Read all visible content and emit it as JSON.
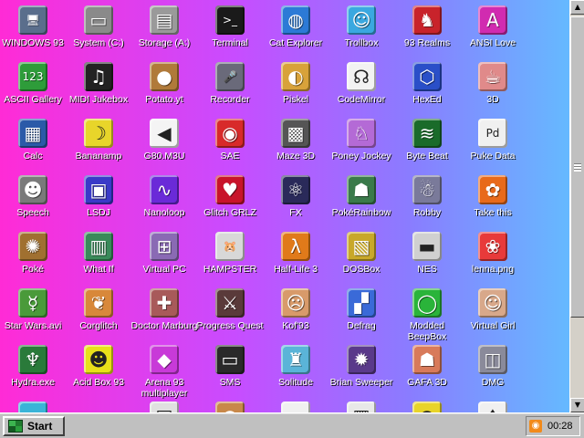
{
  "desktop": {
    "rows": [
      [
        {
          "label": "WINDOWS 93",
          "icon": "computer-icon",
          "glyph": "🖥",
          "color": "#5a6e8c"
        },
        {
          "label": "System (C:)",
          "icon": "hard-drive-icon",
          "glyph": "▭",
          "color": "#8a8a8a"
        },
        {
          "label": "Storage (A:)",
          "icon": "floppy-drive-icon",
          "glyph": "▤",
          "color": "#9a9a9a"
        },
        {
          "label": "Terminal",
          "icon": "terminal-icon",
          "glyph": ">_",
          "color": "#1a1a1a"
        },
        {
          "label": "Cat Explorer",
          "icon": "globe-cat-icon",
          "glyph": "◍",
          "color": "#2c7ad6"
        },
        {
          "label": "Trollbox",
          "icon": "troll-face-icon",
          "glyph": "☺",
          "color": "#3aa8e0"
        },
        {
          "label": "93 Realms",
          "icon": "red-dragon-icon",
          "glyph": "♞",
          "color": "#c8232b"
        },
        {
          "label": "ANSI Love",
          "icon": "letter-a-icon",
          "glyph": "A",
          "color": "#d12bb0"
        }
      ],
      [
        {
          "label": "ASCII Gallery",
          "icon": "ascii-numbers-icon",
          "glyph": "123",
          "color": "#2e9c3a"
        },
        {
          "label": "MIDI Jukebox",
          "icon": "piano-keys-icon",
          "glyph": "♫",
          "color": "#222222"
        },
        {
          "label": "Potato.yt",
          "icon": "potato-icon",
          "glyph": "●",
          "color": "#b07a3a"
        },
        {
          "label": "Recorder",
          "icon": "microphone-icon",
          "glyph": "🎤",
          "color": "#6a6a7a"
        },
        {
          "label": "Piskel",
          "icon": "paint-palette-icon",
          "glyph": "◐",
          "color": "#d8a23a"
        },
        {
          "label": "CodeMirror",
          "icon": "code-mirror-icon",
          "glyph": "☊",
          "color": "#f2f2f2"
        },
        {
          "label": "HexEd",
          "icon": "hex-cube-icon",
          "glyph": "⬡",
          "color": "#2a4fc8"
        },
        {
          "label": "3D",
          "icon": "teapot-icon",
          "glyph": "☕",
          "color": "#e08a8a"
        }
      ],
      [
        {
          "label": "Calc",
          "icon": "calculator-icon",
          "glyph": "▦",
          "color": "#2b5aa8"
        },
        {
          "label": "Bananamp",
          "icon": "banana-icon",
          "glyph": "☽",
          "color": "#e8d52a"
        },
        {
          "label": "G80.M3U",
          "icon": "playlist-file-icon",
          "glyph": "◀",
          "color": "#f4f4f4"
        },
        {
          "label": "SAE",
          "icon": "checkered-ball-icon",
          "glyph": "◉",
          "color": "#d82a2a"
        },
        {
          "label": "Maze 3D",
          "icon": "maze-icon",
          "glyph": "▩",
          "color": "#555555"
        },
        {
          "label": "Poney Jockey",
          "icon": "pony-icon",
          "glyph": "♘",
          "color": "#b46ad6"
        },
        {
          "label": "Byte Beat",
          "icon": "byte-beat-icon",
          "glyph": "≋",
          "color": "#1a6b2a"
        },
        {
          "label": "Puke Data",
          "icon": "document-pd-icon",
          "glyph": "Pd",
          "color": "#f0f0f0"
        }
      ],
      [
        {
          "label": "Speech",
          "icon": "face-speech-icon",
          "glyph": "☻",
          "color": "#7a7a7a"
        },
        {
          "label": "LSDJ",
          "icon": "gameboy-icon",
          "glyph": "▣",
          "color": "#3a3ac8"
        },
        {
          "label": "Nanoloop",
          "icon": "waveform-icon",
          "glyph": "∿",
          "color": "#6a2ad8"
        },
        {
          "label": "Glitch GRLZ",
          "icon": "red-lips-icon",
          "glyph": "♥",
          "color": "#c8142a"
        },
        {
          "label": "FX",
          "icon": "atom-icon",
          "glyph": "⚛",
          "color": "#2a2a5a"
        },
        {
          "label": "PokéRainbow",
          "icon": "pokemon-group-icon",
          "glyph": "☗",
          "color": "#3a7a4a"
        },
        {
          "label": "Robby",
          "icon": "stick-figure-icon",
          "glyph": "☃",
          "color": "#7a7a9a"
        },
        {
          "label": "Take this",
          "icon": "orange-creature-icon",
          "glyph": "✿",
          "color": "#e86a1a"
        }
      ],
      [
        {
          "label": "Poké",
          "icon": "poke-ascii-icon",
          "glyph": "✺",
          "color": "#a07030"
        },
        {
          "label": "What If",
          "icon": "what-if-window-icon",
          "glyph": "▥",
          "color": "#3a8a5a"
        },
        {
          "label": "Virtual PC",
          "icon": "virtual-pc-icon",
          "glyph": "⊞",
          "color": "#8a6ab4"
        },
        {
          "label": "HAMPSTER",
          "icon": "hamster-icon",
          "glyph": "🐹",
          "color": "#d8d8d8"
        },
        {
          "label": "Half-Life 3",
          "icon": "lambda-icon",
          "glyph": "λ",
          "color": "#e07a1a"
        },
        {
          "label": "DOSBox",
          "icon": "dosbox-icon",
          "glyph": "▧",
          "color": "#c8a82a"
        },
        {
          "label": "NES",
          "icon": "nes-console-icon",
          "glyph": "▬",
          "color": "#d0d0d0"
        },
        {
          "label": "lenna.png",
          "icon": "image-file-icon",
          "glyph": "❀",
          "color": "#e83a3a"
        }
      ],
      [
        {
          "label": "Star Wars.avi",
          "icon": "yoda-icon",
          "glyph": "☿",
          "color": "#4a9a3a"
        },
        {
          "label": "Corglitch",
          "icon": "corgi-icon",
          "glyph": "❦",
          "color": "#d8883a"
        },
        {
          "label": "Doctor Marburg",
          "icon": "doctor-icon",
          "glyph": "✚",
          "color": "#a85a5a"
        },
        {
          "label": "Progress Quest",
          "icon": "crossed-swords-icon",
          "glyph": "⚔",
          "color": "#5a3a3a"
        },
        {
          "label": "Kof'93",
          "icon": "fighter-face-icon",
          "glyph": "☹",
          "color": "#d89a6a"
        },
        {
          "label": "Defrag",
          "icon": "defrag-icon",
          "glyph": "▞",
          "color": "#3a6ad8"
        },
        {
          "label": "Modded BeepBox",
          "icon": "green-ring-icon",
          "glyph": "◯",
          "color": "#2ab43a"
        },
        {
          "label": "Virtual Girl",
          "icon": "portrait-icon",
          "glyph": "☺",
          "color": "#d8a88a"
        }
      ],
      [
        {
          "label": "Hydra.exe",
          "icon": "hydra-icon",
          "glyph": "♆",
          "color": "#2a7a3a"
        },
        {
          "label": "Acid Box 93",
          "icon": "smiley-icon",
          "glyph": "☻",
          "color": "#e8e01a"
        },
        {
          "label": "Arena 93 multiplayer",
          "icon": "cube-icon",
          "glyph": "◆",
          "color": "#c83ad8"
        },
        {
          "label": "SMS",
          "icon": "master-system-icon",
          "glyph": "▭",
          "color": "#2a2a2a"
        },
        {
          "label": "Solitude",
          "icon": "bottle-icon",
          "glyph": "♜",
          "color": "#5ab4d8"
        },
        {
          "label": "Brian Sweeper",
          "icon": "mine-icon",
          "glyph": "✹",
          "color": "#5a3a8a"
        },
        {
          "label": "GAFA 3D",
          "icon": "businessman-icon",
          "glyph": "☗",
          "color": "#d87a5a"
        },
        {
          "label": "DMG",
          "icon": "drive-icon",
          "glyph": "◫",
          "color": "#8a8a9a"
        }
      ],
      [
        {
          "label": "",
          "icon": "cloud-icon",
          "glyph": "☁",
          "color": "#3ab4d8"
        },
        {
          "label": "",
          "icon": "blank-icon",
          "glyph": "",
          "color": "transparent"
        },
        {
          "label": "",
          "icon": "document-icon",
          "glyph": "▤",
          "color": "#e0e0e0"
        },
        {
          "label": "",
          "icon": "cookie-icon",
          "glyph": "●",
          "color": "#c8884a"
        },
        {
          "label": "",
          "icon": "paper-icon",
          "glyph": "▭",
          "color": "#f0f0f0"
        },
        {
          "label": "",
          "icon": "notes-icon",
          "glyph": "▥",
          "color": "#e8e8e8"
        },
        {
          "label": "",
          "icon": "yellow-ball-icon",
          "glyph": "●",
          "color": "#e8d42a"
        },
        {
          "label": "",
          "icon": "cards-icon",
          "glyph": "♠",
          "color": "#f0f0f0"
        }
      ]
    ]
  },
  "scrollbar": {
    "up": "▲",
    "down": "▼"
  },
  "taskbar": {
    "start_label": "Start",
    "clock": "00:28",
    "tray_icon": "rss-icon",
    "tray_glyph": "◉"
  }
}
